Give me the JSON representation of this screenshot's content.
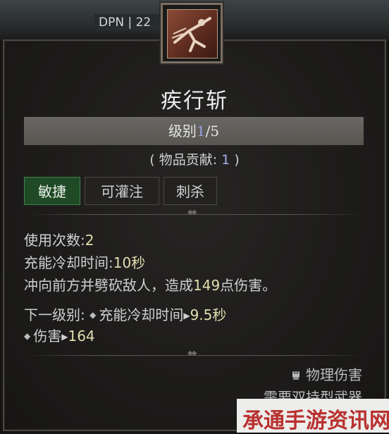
{
  "background": {
    "top_text": "",
    "dpn_tag": "DPN | 22"
  },
  "skill": {
    "icon": "dash-slash-skill-icon",
    "name": "疾行斩",
    "level_label": "级别",
    "level_current": "1",
    "level_max": "/5",
    "contribution_label": "( 物品贡献:",
    "contribution_value": "1",
    "contribution_close": ")"
  },
  "tags": [
    {
      "label": "敏捷",
      "active": true
    },
    {
      "label": "可灌注",
      "active": false
    },
    {
      "label": "刺杀",
      "active": false
    }
  ],
  "stats": {
    "uses_label": "使用次数:",
    "uses_value": "2",
    "cooldown_label": "充能冷却时间:",
    "cooldown_value": "10秒",
    "desc_prefix": "冲向前方并劈砍敌人，造成",
    "desc_damage": "149",
    "desc_suffix": "点伤害。"
  },
  "next_level": {
    "label": "下一级别:",
    "cooldown_label": "充能冷却时间",
    "cooldown_value": "9.5秒",
    "damage_label": "伤害",
    "damage_value": "164"
  },
  "footer": {
    "damage_type": "物理伤害",
    "damage_type_icon": "fist-icon",
    "requirement": "需要双持型武器"
  },
  "watermark": {
    "text": "承通手游资讯网"
  },
  "colors": {
    "highlight": "#e1ddae",
    "level_value": "#9aa2e6",
    "active_tag": "#1f4a25"
  }
}
